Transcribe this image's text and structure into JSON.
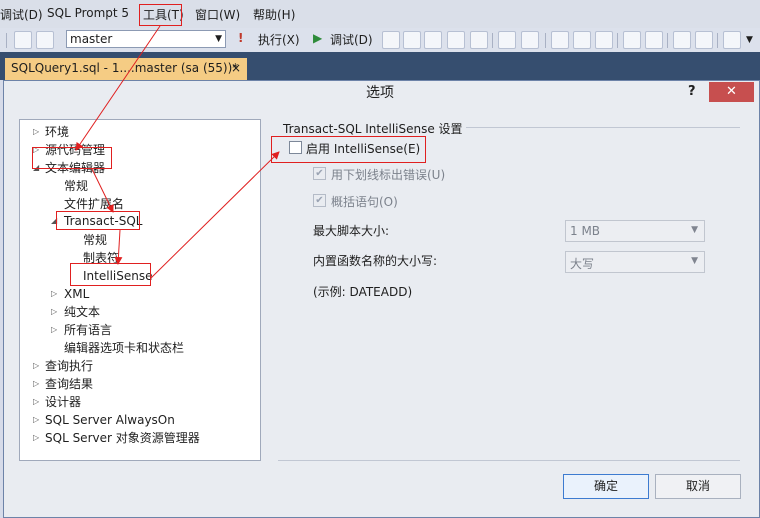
{
  "menubar": {
    "items": [
      "调试(D)",
      "SQL Prompt 5",
      "工具(T)",
      "窗口(W)",
      "帮助(H)"
    ]
  },
  "toolbar": {
    "database": "master",
    "execute_label": "执行(X)",
    "debug_label": "调试(D)"
  },
  "tab": {
    "title": "SQLQuery1.sql - 1....master (sa (55))*",
    "close": "×"
  },
  "dialog": {
    "title": "选项",
    "help": "?",
    "close": "✕",
    "ok_label": "确定",
    "cancel_label": "取消"
  },
  "tree": {
    "nodes": [
      {
        "label": "环境",
        "expander": "▷"
      },
      {
        "label": "源代码管理",
        "expander": "▷"
      },
      {
        "label": "文本编辑器",
        "expander": "◢"
      },
      {
        "label": "常规",
        "expander": ""
      },
      {
        "label": "文件扩展名",
        "expander": ""
      },
      {
        "label": "Transact-SQL",
        "expander": "◢"
      },
      {
        "label": "常规",
        "expander": ""
      },
      {
        "label": "制表符",
        "expander": ""
      },
      {
        "label": "IntelliSense",
        "expander": ""
      },
      {
        "label": "XML",
        "expander": "▷"
      },
      {
        "label": "纯文本",
        "expander": "▷"
      },
      {
        "label": "所有语言",
        "expander": "▷"
      },
      {
        "label": "编辑器选项卡和状态栏",
        "expander": ""
      },
      {
        "label": "查询执行",
        "expander": "▷"
      },
      {
        "label": "查询结果",
        "expander": "▷"
      },
      {
        "label": "设计器",
        "expander": "▷"
      },
      {
        "label": "SQL Server AlwaysOn",
        "expander": "▷"
      },
      {
        "label": "SQL Server 对象资源管理器",
        "expander": "▷"
      }
    ]
  },
  "settings": {
    "section_title": "Transact-SQL IntelliSense 设置",
    "enable_intellisense": "启用 IntelliSense(E)",
    "underline_errors": "用下划线标出错误(U)",
    "outline_statements": "概括语句(O)",
    "max_script_size_label": "最大脚本大小:",
    "max_script_size_value": "1 MB",
    "builtin_case_label": "内置函数名称的大小写:",
    "builtin_case_value": "大写",
    "example": "(示例: DATEADD)"
  },
  "colors": {
    "annotation": "#e02020",
    "tab_active": "#f5cc84",
    "close_button": "#c74f4f"
  }
}
